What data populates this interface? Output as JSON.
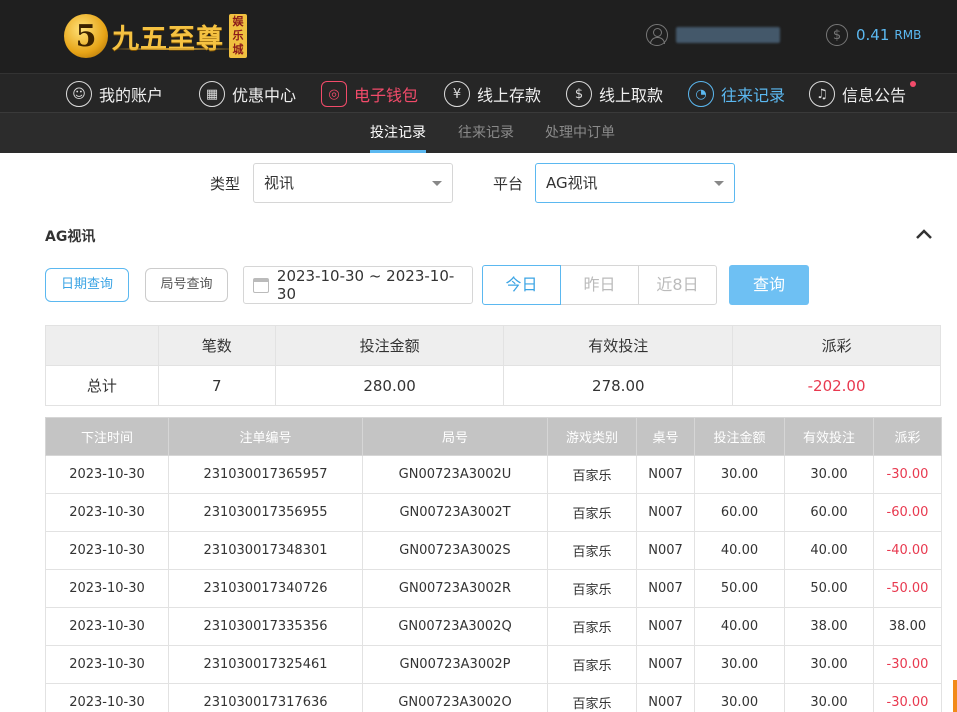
{
  "brand": {
    "logo_digit": "5",
    "name": "九五至尊",
    "tag": [
      "娱",
      "乐",
      "城"
    ]
  },
  "account": {
    "balance": "0.41",
    "currency": "RMB"
  },
  "nav": [
    {
      "label": "我的账户",
      "icon": "user-icon",
      "glyph": "☺"
    },
    {
      "label": "优惠中心",
      "icon": "gift-icon",
      "glyph": "▦"
    },
    {
      "label": "电子钱包",
      "icon": "wallet-icon",
      "glyph": "◎"
    },
    {
      "label": "线上存款",
      "icon": "deposit-icon",
      "glyph": "¥"
    },
    {
      "label": "线上取款",
      "icon": "withdraw-icon",
      "glyph": "$"
    },
    {
      "label": "往来记录",
      "icon": "records-icon",
      "glyph": "◔"
    },
    {
      "label": "信息公告",
      "icon": "bell-icon",
      "glyph": "♫"
    }
  ],
  "subtabs": [
    "投注记录",
    "往来记录",
    "处理中订单"
  ],
  "filters": {
    "type_label": "类型",
    "type_value": "视讯",
    "platform_label": "平台",
    "platform_value": "AG视讯"
  },
  "section_title": "AG视讯",
  "query": {
    "date_btn": "日期查询",
    "round_btn": "局号查询",
    "date_range": "2023-10-30 ~ 2023-10-30",
    "quick": [
      "今日",
      "昨日",
      "近8日"
    ],
    "search_btn": "查询"
  },
  "summary": {
    "headers": [
      "",
      "笔数",
      "投注金额",
      "有效投注",
      "派彩"
    ],
    "row": [
      "总计",
      "7",
      "280.00",
      "278.00",
      "-202.00"
    ]
  },
  "detail": {
    "headers": [
      "下注时间",
      "注单编号",
      "局号",
      "游戏类别",
      "桌号",
      "投注金额",
      "有效投注",
      "派彩"
    ],
    "rows": [
      [
        "2023-10-30",
        "231030017365957",
        "GN00723A3002U",
        "百家乐",
        "N007",
        "30.00",
        "30.00",
        "-30.00"
      ],
      [
        "2023-10-30",
        "231030017356955",
        "GN00723A3002T",
        "百家乐",
        "N007",
        "60.00",
        "60.00",
        "-60.00"
      ],
      [
        "2023-10-30",
        "231030017348301",
        "GN00723A3002S",
        "百家乐",
        "N007",
        "40.00",
        "40.00",
        "-40.00"
      ],
      [
        "2023-10-30",
        "231030017340726",
        "GN00723A3002R",
        "百家乐",
        "N007",
        "50.00",
        "50.00",
        "-50.00"
      ],
      [
        "2023-10-30",
        "231030017335356",
        "GN00723A3002Q",
        "百家乐",
        "N007",
        "40.00",
        "38.00",
        "38.00"
      ],
      [
        "2023-10-30",
        "231030017325461",
        "GN00723A3002P",
        "百家乐",
        "N007",
        "30.00",
        "30.00",
        "-30.00"
      ],
      [
        "2023-10-30",
        "231030017317636",
        "GN00723A3002O",
        "百家乐",
        "N007",
        "30.00",
        "30.00",
        "-30.00"
      ]
    ]
  },
  "colors": {
    "accent": "#5bb8f0",
    "negative": "#e8394f",
    "wallet": "#f24b6a",
    "gold": "#f5c242"
  }
}
